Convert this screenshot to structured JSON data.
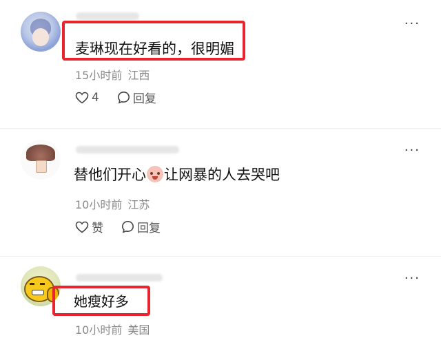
{
  "comments": [
    {
      "text": "麦琳现在好看的，很明媚",
      "time": "15小时前",
      "location": "江西",
      "like_label": "4",
      "reply_label": "回复",
      "more_label": "···",
      "highlighted": true
    },
    {
      "text_before": "替他们开心",
      "text_after": "让网暴的人去哭吧",
      "emoji_icon": "blushing-face-emoji",
      "time": "10小时前",
      "location": "江苏",
      "like_label": "赞",
      "reply_label": "回复",
      "more_label": "···",
      "highlighted": false
    },
    {
      "text": "她瘦好多",
      "time": "10小时前",
      "location": "美国",
      "more_label": "···",
      "highlighted": true
    }
  ],
  "colors": {
    "highlight_border": "#e8242f",
    "meta_text": "#8a8a8a",
    "body_text": "#111111"
  }
}
